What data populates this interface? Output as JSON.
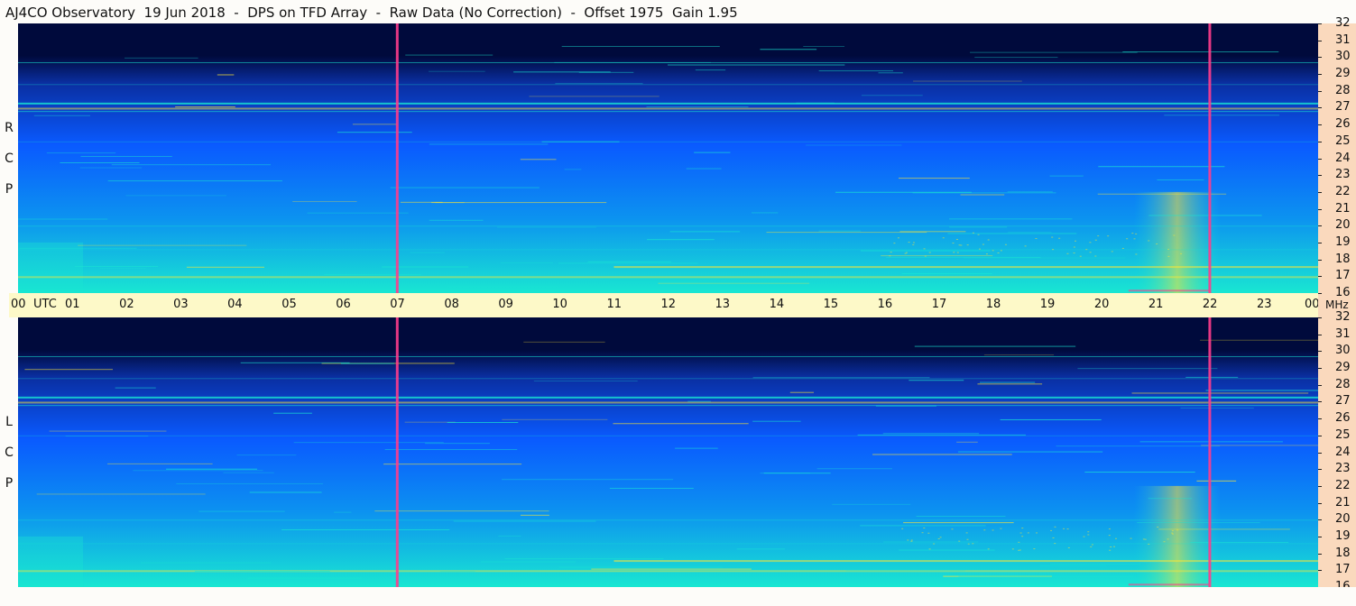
{
  "title": "AJ4CO Observatory  19 Jun 2018  -  DPS on TFD Array  -  Raw Data (No Correction)  -  Offset 1975  Gain 1.95",
  "chart_data": {
    "type": "heatmap",
    "title": "AJ4CO Observatory  19 Jun 2018  -  DPS on TFD Array  -  Raw Data (No Correction)  -  Offset 1975  Gain 1.95",
    "x_unit_label": "UTC",
    "y_unit_label": "MHz",
    "xlim": [
      0,
      24
    ],
    "ylim": [
      16,
      32
    ],
    "x_ticks": [
      "00",
      "01",
      "02",
      "03",
      "04",
      "05",
      "06",
      "07",
      "08",
      "09",
      "10",
      "11",
      "12",
      "13",
      "14",
      "15",
      "16",
      "17",
      "18",
      "19",
      "20",
      "21",
      "22",
      "23",
      "00"
    ],
    "y_ticks": [
      "16",
      "17",
      "18",
      "19",
      "20",
      "21",
      "22",
      "23",
      "24",
      "25",
      "26",
      "27",
      "28",
      "29",
      "30",
      "31",
      "32"
    ],
    "panels": [
      {
        "polarization_letters": [
          "R",
          "C",
          "P"
        ]
      },
      {
        "polarization_letters": [
          "L",
          "C",
          "P"
        ]
      }
    ],
    "colors": {
      "low": "#000a3c",
      "mid": "#0a5aff",
      "high": "#19e6d2",
      "hot": "#ffe632",
      "marker": "#ff3c8c"
    }
  }
}
